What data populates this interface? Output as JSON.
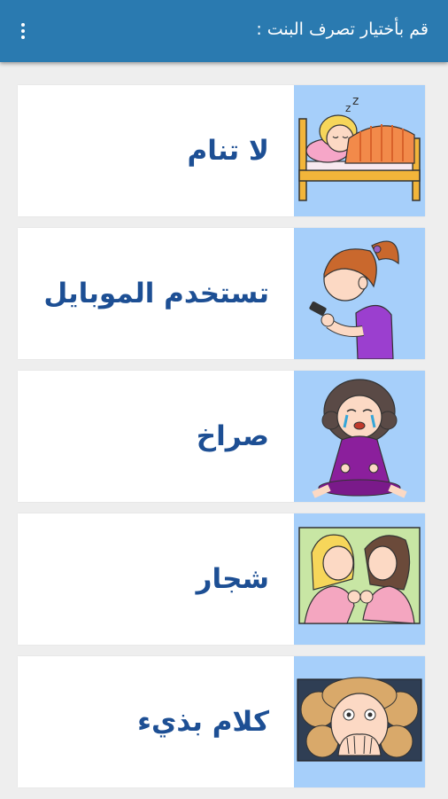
{
  "header": {
    "title": "قم بأختيار تصرف البنت :",
    "menu_icon": "more-vert-icon"
  },
  "colors": {
    "appbar": "#2a7ab0",
    "label_text": "#1d4f94",
    "image_background": "#a6cffa"
  },
  "items": [
    {
      "label": "لا تنام",
      "image": "girl-sleeping-in-bed"
    },
    {
      "label": "تستخدم الموبايل",
      "image": "girl-using-mobile-phone"
    },
    {
      "label": "صراخ",
      "image": "girl-crying"
    },
    {
      "label": "شجار",
      "image": "girls-fighting"
    },
    {
      "label": "كلام بذيء",
      "image": "girl-covering-mouth"
    }
  ]
}
